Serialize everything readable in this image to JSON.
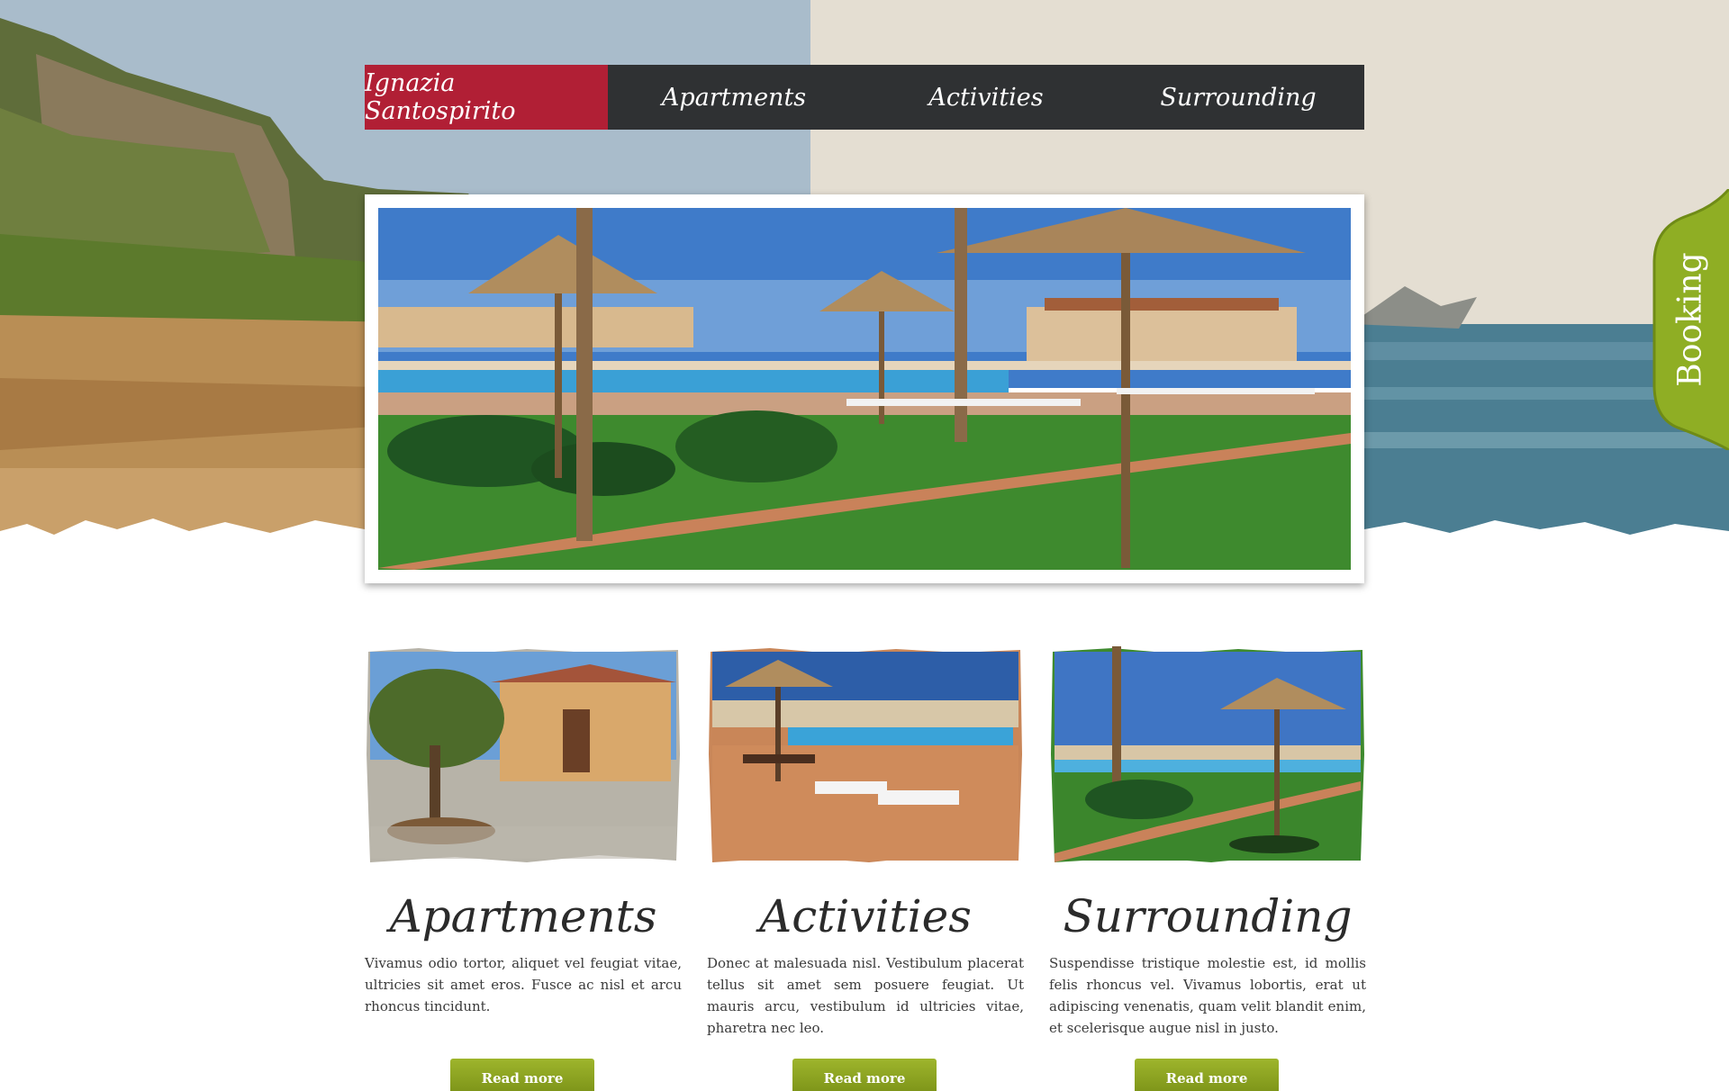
{
  "nav": {
    "items": [
      {
        "label": "Ignazia Santospirito",
        "active": true
      },
      {
        "label": "Apartments",
        "active": false
      },
      {
        "label": "Activities",
        "active": false
      },
      {
        "label": "Surrounding",
        "active": false
      }
    ]
  },
  "booking": {
    "label": "Booking"
  },
  "columns": [
    {
      "title": "Apartments",
      "text": "Vivamus odio tortor, aliquet vel feugiat vitae, ultricies sit amet eros. Fusce ac nisl et arcu rhoncus tincidunt.",
      "button": "Read more"
    },
    {
      "title": "Activities",
      "text": "Donec at malesuada nisl. Vestibulum placerat tellus sit amet sem posuere feugiat. Ut mauris arcu, vestibulum id ultricies vitae, pharetra nec leo.",
      "button": "Read more"
    },
    {
      "title": "Surrounding",
      "text": "Suspendisse tristique molestie est, id mollis felis rhoncus vel. Vivamus lobortis, erat ut adipiscing venenatis, quam velit blandit enim, et scelerisque augue nisl in justo.",
      "button": "Read more"
    }
  ],
  "colors": {
    "nav_bg": "#2f3133",
    "nav_active": "#b11f35",
    "button_green": "#8ca521",
    "booking_green": "#8fae24"
  }
}
